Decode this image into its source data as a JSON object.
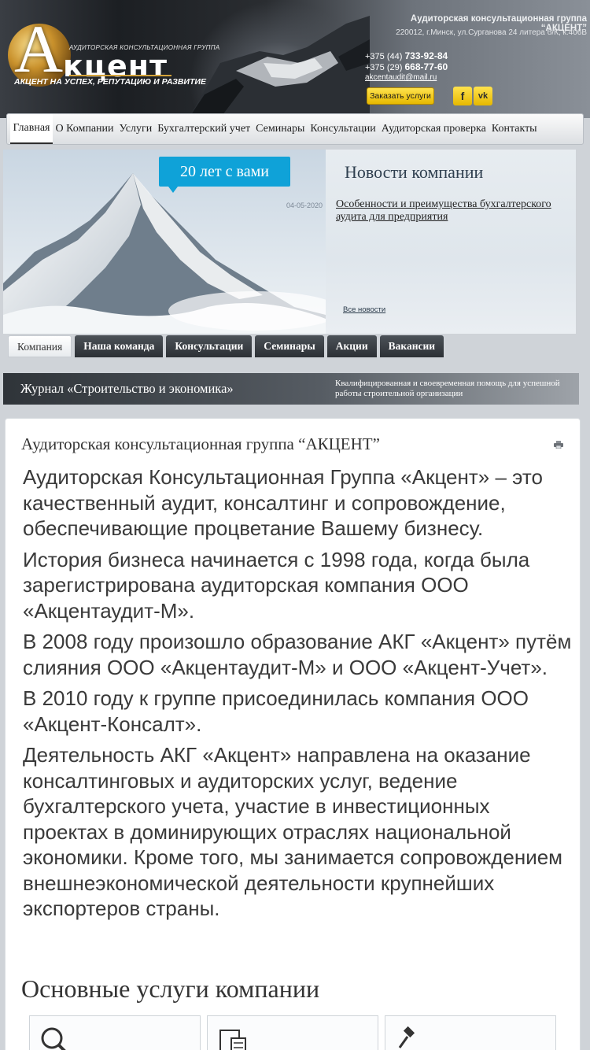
{
  "header": {
    "logo_small": "АУДИТОРСКАЯ КОНСУЛЬТАЦИОННАЯ ГРУППА",
    "logo_letter": "А",
    "logo_word": "кцент",
    "slogan": "АКЦЕНТ НА УСПЕХ, РЕПУТАЦИЮ И РАЗВИТИЕ",
    "company_title": "Аудиторская консультационная группа “АКЦЕНТ”",
    "address": "220012, г.Минск, ул.Сурганова 24 литера б/К, к.406В",
    "phone1_prefix": "+375 (44)",
    "phone1_number": "733-92-84",
    "phone2_prefix": "+375 (29)",
    "phone2_number": "668-77-60",
    "email": "akcentaudit@mail.ru",
    "order_button": "Заказать услуги",
    "social": [
      {
        "name": "facebook-icon",
        "glyph": "f"
      },
      {
        "name": "vk-icon",
        "glyph": "vk"
      }
    ]
  },
  "nav": {
    "items": [
      "Главная",
      "О Компании",
      "Услуги",
      "Бухгалтерский учет",
      "Семинары",
      "Консультации",
      "Аудиторская проверка",
      "Контакты"
    ],
    "active": "Главная"
  },
  "banner": {
    "years_badge": "20 лет с вами",
    "news_title": "Новости компании",
    "news_date": "04-05-2020",
    "news_link": "Особенности и преимущества бухгалтерского аудита для предприятия",
    "all_news": "Все новости"
  },
  "tabs": {
    "items": [
      "Компания",
      "Наша команда",
      "Консультации",
      "Семинары",
      "Акции",
      "Вакансии"
    ],
    "active": "Компания"
  },
  "journal": {
    "title": "Журнал «Строительство и экономика»",
    "description": "Квалифицированная и своевременная помощь для успешной работы строительной организации"
  },
  "content": {
    "title": "Аудиторская консультационная группа “АКЦЕНТ”",
    "paragraphs": [
      "Аудиторская Консультационная Группа «Акцент» – это качественный аудит, консалтинг и сопровождение, обеспечивающие процветание Вашему бизнесу.",
      "История бизнеса начинается с 1998 года, когда была зарегистрирована аудиторская компания ООО «Акцентаудит-М».",
      "В 2008 году произошло образование АКГ «Акцент» путём слияния ООО «Акцентаудит-М» и ООО «Акцент-Учет».",
      "В 2010 году к группе присоединилась компания ООО «Акцент-Консалт».",
      "Деятельность АКГ «Акцент» направлена на оказание консалтинговых и аудиторских услуг, ведение бухгалтерского учета, участие в инвестиционных проектах в доминирующих отраслях национальной экономики. Кроме того, мы занимается сопровождением внешнеэкономической деятельности крупнейших экспортеров страны."
    ],
    "services_title": "Основные услуги компании"
  },
  "colors": {
    "accent_blue": "#0fa2d8",
    "button_yellow": "#ffd21f",
    "dark_bar": "#2f3439"
  }
}
